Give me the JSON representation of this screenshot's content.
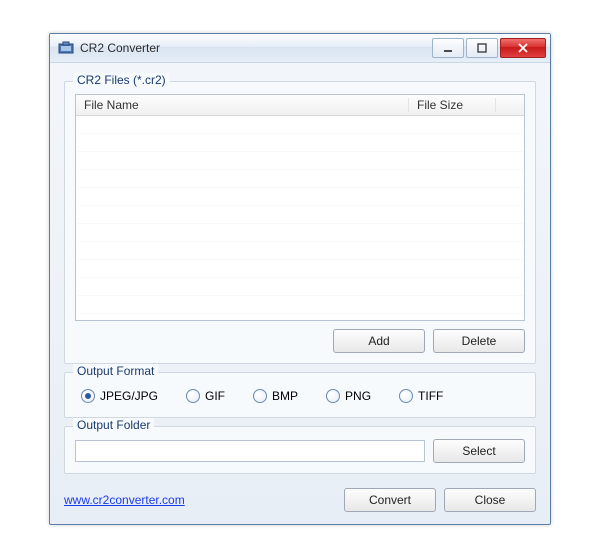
{
  "window": {
    "title": "CR2 Converter"
  },
  "files_group": {
    "label": "CR2 Files (*.cr2)",
    "columns": {
      "filename": "File Name",
      "filesize": "File Size"
    },
    "add_label": "Add",
    "delete_label": "Delete"
  },
  "format_group": {
    "label": "Output Format",
    "options": {
      "jpeg": "JPEG/JPG",
      "gif": "GIF",
      "bmp": "BMP",
      "png": "PNG",
      "tiff": "TIFF"
    },
    "selected": "jpeg"
  },
  "folder_group": {
    "label": "Output Folder",
    "value": "",
    "select_label": "Select"
  },
  "footer": {
    "link": "www.cr2converter.com",
    "convert_label": "Convert",
    "close_label": "Close"
  }
}
